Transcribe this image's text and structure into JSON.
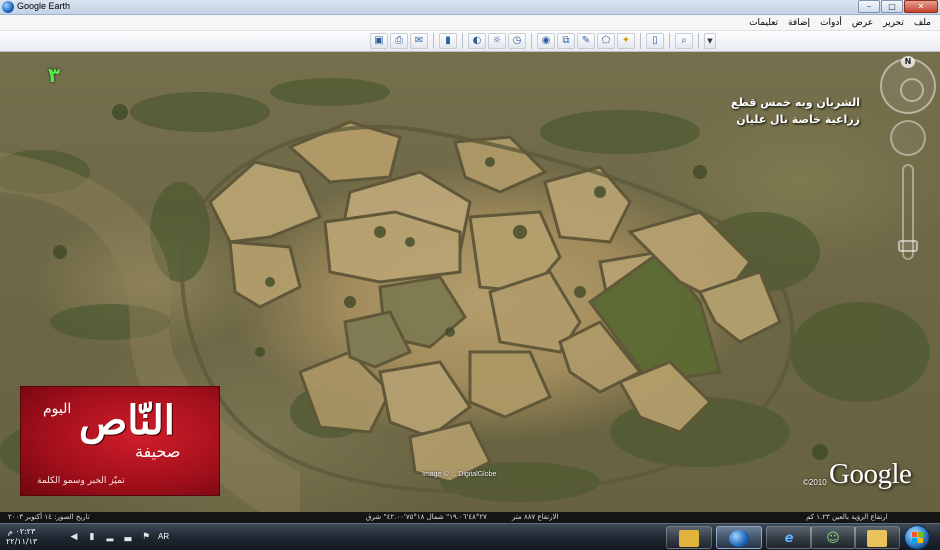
{
  "window": {
    "title": "Google Earth",
    "controls": {
      "minimize": "–",
      "maximize": "□",
      "close": "✕"
    }
  },
  "menu": [
    "ملف",
    "تحرير",
    "عرض",
    "أدوات",
    "إضافة",
    "تعليمات"
  ],
  "toolbar": {
    "right_group": [
      "sidebar-icon",
      "placemark-icon",
      "polygon-icon",
      "path-icon",
      "image-overlay-icon",
      "record-tour-icon"
    ],
    "middle_group": [
      "historical-imagery-icon",
      "sun-icon",
      "planets-icon",
      "ruler-icon"
    ],
    "left_group": [
      "email-icon",
      "print-icon",
      "save-image-icon"
    ],
    "search_icon": "search-icon"
  },
  "map": {
    "number_marker": "٣",
    "caption_line1": "الشريان وبه خمس قطع",
    "caption_line2": "زراعية خاصة بال عليان",
    "imagery_credit": "Image © ... DigitalGlobe",
    "copyright": "©2010",
    "google_logo": "Google",
    "compass_north": "N"
  },
  "logo": {
    "al_yawm": "اليوم",
    "al_nas": "النّاص",
    "sahifa": "صحيفة",
    "tagline": "تميّز الخبر وسمو الكلمة"
  },
  "statusbar": {
    "imagery_date": "تاريخ الصور: ١٤ أكتوبر ٢٠٠٣",
    "coordinates": "٢٧°٤٨'١٩.٠٦\" شمال ١٨°٧٥'٤٢.٠٠\" شرق",
    "elevation": "الارتفاع ٨٨٧ متر",
    "eye_alt": "ارتفاع الرؤية بالعين ١.٢٣ كم"
  },
  "taskbar": {
    "clock_time": "٠٢:٢٣ م",
    "clock_date": "٢٢/١١/١٣",
    "language": "AR",
    "buttons": [
      "media-player-icon",
      "google-earth-icon",
      "internet-explorer-icon",
      "users-icon",
      "folder-icon"
    ]
  }
}
